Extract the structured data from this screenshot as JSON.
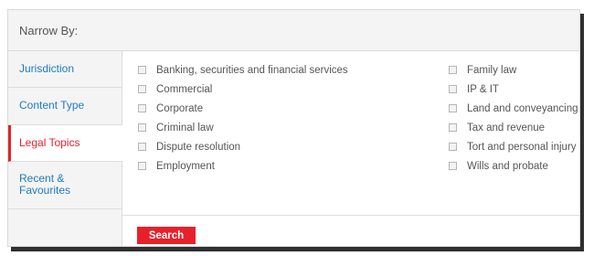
{
  "header": {
    "title": "Narrow By:"
  },
  "tabs": [
    {
      "label": "Jurisdiction",
      "active": false
    },
    {
      "label": "Content Type",
      "active": false
    },
    {
      "label": "Legal Topics",
      "active": true
    },
    {
      "label": "Recent & Favourites",
      "active": false
    }
  ],
  "topics": {
    "left": [
      "Banking, securities and financial services",
      "Commercial",
      "Corporate",
      "Criminal law",
      "Dispute resolution",
      "Employment"
    ],
    "right": [
      "Family law",
      "IP & IT",
      "Land and conveyancing",
      "Tax and revenue",
      "Tort and personal injury",
      "Wills and probate"
    ]
  },
  "footer": {
    "search_label": "Search"
  },
  "colors": {
    "accent": "#e8202a",
    "link": "#1f7bc1"
  }
}
